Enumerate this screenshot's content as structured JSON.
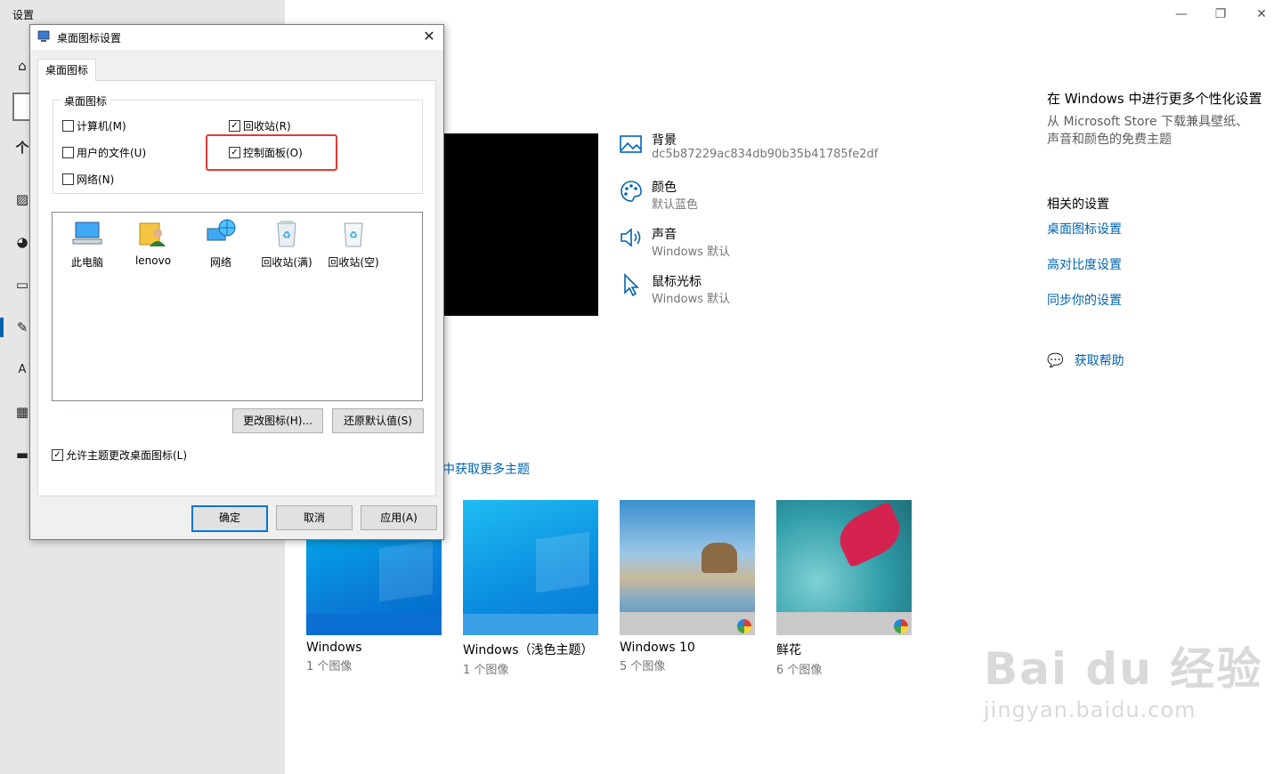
{
  "app": {
    "title": "设置"
  },
  "window_controls": {
    "minimize": "—",
    "restore": "❐",
    "close": "✕"
  },
  "options": [
    {
      "title": "背景",
      "sub": "dc5b87229ac834db90b35b41785fe2df",
      "icon": "picture-icon"
    },
    {
      "title": "颜色",
      "sub": "默认蓝色",
      "icon": "palette-icon"
    },
    {
      "title": "声音",
      "sub": "Windows 默认",
      "icon": "speaker-icon"
    },
    {
      "title": "鼠标光标",
      "sub": "Windows 默认",
      "icon": "cursor-icon"
    }
  ],
  "right_col": {
    "promo_title": "在 Windows 中进行更多个性化设置",
    "promo_text": "从 Microsoft Store 下载兼具壁纸、声音和颜色的免费主题",
    "related_title": "相关的设置",
    "links": [
      "桌面图标设置",
      "高对比度设置",
      "同步你的设置"
    ],
    "help": "获取帮助"
  },
  "get_more_themes": "中获取更多主题",
  "themes": [
    {
      "name": "Windows",
      "count": "1 个图像"
    },
    {
      "name": "Windows（浅色主题）",
      "count": "1 个图像"
    },
    {
      "name": "Windows 10",
      "count": "5 个图像"
    },
    {
      "name": "鲜花",
      "count": "6 个图像"
    }
  ],
  "dialog": {
    "title": "桌面图标设置",
    "tab": "桌面图标",
    "group_label": "桌面图标",
    "checkboxes": [
      {
        "label": "计算机(M)",
        "checked": false
      },
      {
        "label": "回收站(R)",
        "checked": true
      },
      {
        "label": "用户的文件(U)",
        "checked": false
      },
      {
        "label": "控制面板(O)",
        "checked": true
      },
      {
        "label": "网络(N)",
        "checked": false
      }
    ],
    "icons": [
      "此电脑",
      "lenovo",
      "网络",
      "回收站(满)",
      "回收站(空)"
    ],
    "change_icon": "更改图标(H)...",
    "restore_default": "还原默认值(S)",
    "allow_theme": "允许主题更改桌面图标(L)",
    "allow_theme_checked": true,
    "ok": "确定",
    "cancel": "取消",
    "apply": "应用(A)",
    "close": "✕"
  },
  "watermark": {
    "main": "Bai du 经验",
    "sub": "jingyan.baidu.com"
  },
  "colors": {
    "accent": "#0063b1",
    "highlight": "#e53935",
    "sidebar": "#e6e6e6"
  }
}
